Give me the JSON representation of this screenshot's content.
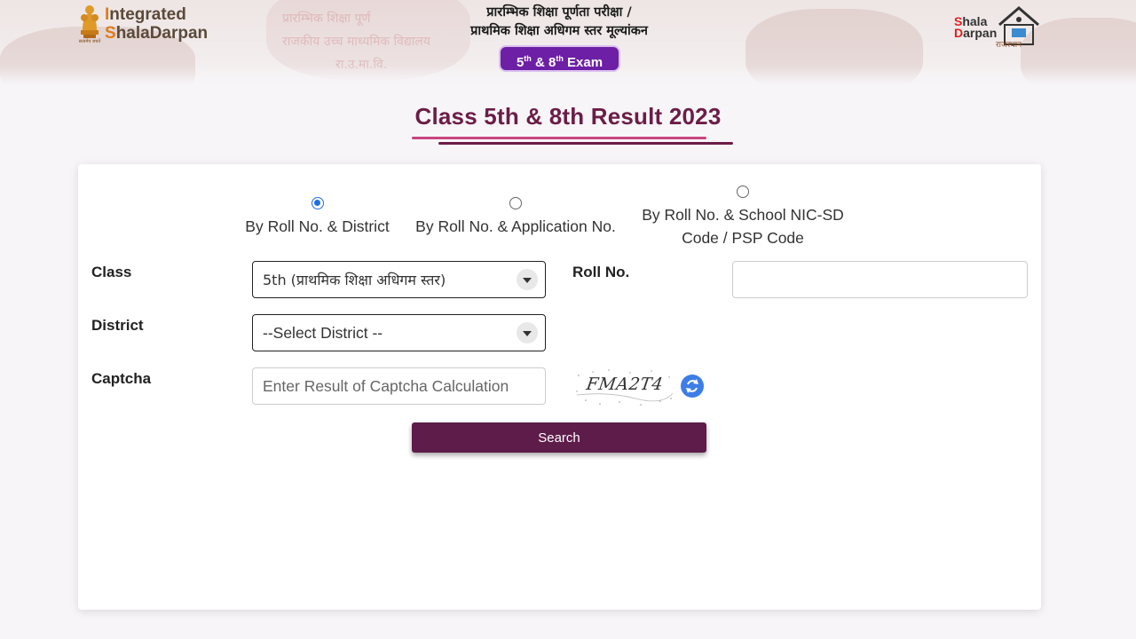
{
  "header": {
    "brand_line1_prefix": "I",
    "brand_line1_rest": "ntegrated",
    "brand_line2_prefix": "S",
    "brand_line2_rest": "halaDarpan",
    "emblem_caption": "सत्यमेव जयते",
    "hindi_title_line1": "प्रारम्भिक शिक्षा पूर्णता परीक्षा /",
    "hindi_title_line2": "प्राथमिक शिक्षा अधिगम स्तर मूल्यांकन",
    "exam_badge": {
      "num1": "5",
      "sup1": "th",
      "amp": "&",
      "num2": "8",
      "sup2": "th",
      "word": "Exam"
    },
    "right_logo": {
      "line1_red": "S",
      "line1_rest": "hala",
      "line2_red": "D",
      "line2_rest": "arpan",
      "sub": "राजस्थान"
    },
    "watermark_lines": [
      "प्रारम्भिक शिक्षा पूर्ण",
      "राजकीय उच्च माध्यमिक विद्यालय",
      "रा.उ.मा.वि."
    ]
  },
  "page_title": "Class 5th & 8th Result 2023",
  "search_modes": [
    {
      "label": "By Roll No. & District",
      "checked": true
    },
    {
      "label": "By Roll No. & Application No.",
      "checked": false
    },
    {
      "label": "By Roll No. & School NIC-SD Code / PSP Code",
      "checked": false
    }
  ],
  "form": {
    "class_label": "Class",
    "class_value": "5th (प्राथमिक शिक्षा अधिगम स्तर)",
    "roll_label": "Roll No.",
    "roll_value": "",
    "district_label": "District",
    "district_value": "--Select District --",
    "captcha_label": "Captcha",
    "captcha_placeholder": "Enter Result of Captcha Calculation",
    "captcha_text": "FMA2T4",
    "search_button": "Search"
  },
  "colors": {
    "title": "#6b1d47",
    "search_button": "#5e1c4a",
    "exam_badge": "#6d1fa6",
    "radio_checked": "#1f6fe0",
    "refresh_button": "#3d7de8"
  },
  "icons": [
    "national-emblem-icon",
    "shala-darpan-house-icon",
    "dropdown-arrow-icon",
    "refresh-icon"
  ]
}
